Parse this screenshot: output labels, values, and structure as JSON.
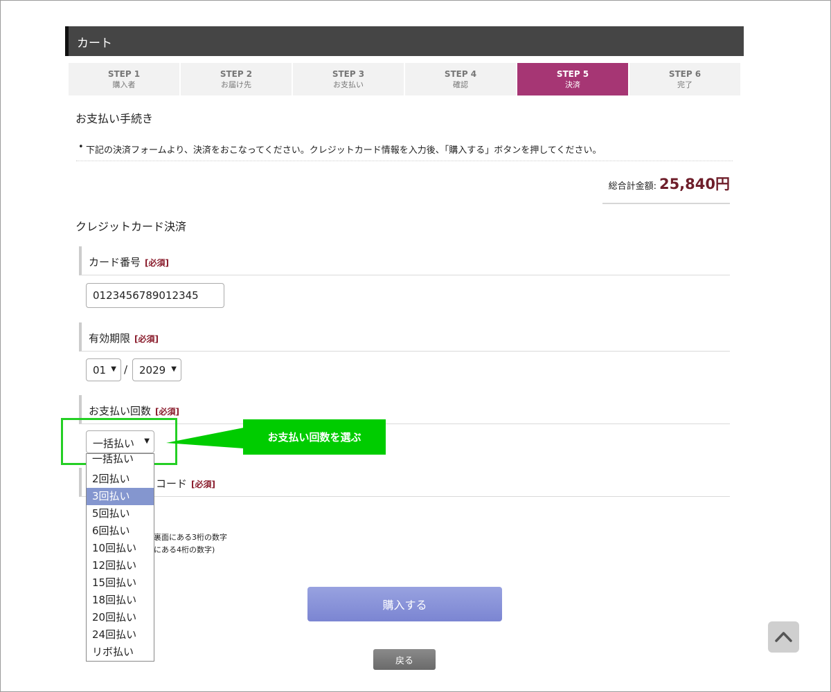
{
  "cart": {
    "title": "カート"
  },
  "steps": [
    {
      "num": "STEP 1",
      "label": "購入者"
    },
    {
      "num": "STEP 2",
      "label": "お届け先"
    },
    {
      "num": "STEP 3",
      "label": "お支払い"
    },
    {
      "num": "STEP 4",
      "label": "確認"
    },
    {
      "num": "STEP 5",
      "label": "決済",
      "active": true
    },
    {
      "num": "STEP 6",
      "label": "完了"
    }
  ],
  "payment": {
    "title": "お支払い手続き",
    "notice": "下記の決済フォームより、決済をおこなってください。クレジットカード情報を入力後、「購入する」ボタンを押してください。"
  },
  "total": {
    "label": "総合計金額:",
    "value": "25,840円"
  },
  "credit": {
    "title": "クレジットカード決済",
    "required_label": "[必須]",
    "card_number": {
      "label": "カード番号",
      "value": "0123456789012345"
    },
    "expiry": {
      "label": "有効期限",
      "month": "01",
      "year": "2029",
      "separator": "/"
    },
    "installments": {
      "label": "お支払い回数",
      "selected": "一括払い",
      "options": [
        "一括払い",
        "2回払い",
        "3回払い",
        "5回払い",
        "6回払い",
        "10回払い",
        "12回払い",
        "15回払い",
        "18回払い",
        "20回払い",
        "24回払い",
        "リボ払い"
      ],
      "highlighted": "3回払い"
    },
    "security_code": {
      "label_visible": "コード",
      "note_line1": "裏面にある3桁の数字",
      "note_line2": "にある4桁の数字)"
    }
  },
  "callout": {
    "text": "お支払い回数を選ぶ"
  },
  "buttons": {
    "buy": "購入する",
    "back": "戻る"
  },
  "colors": {
    "active_step": "#a63674",
    "callout": "#00cc00",
    "price": "#6e1e2a",
    "buy_button": "#8891d8"
  },
  "icons": {
    "page_top": "chevron-up-icon"
  }
}
